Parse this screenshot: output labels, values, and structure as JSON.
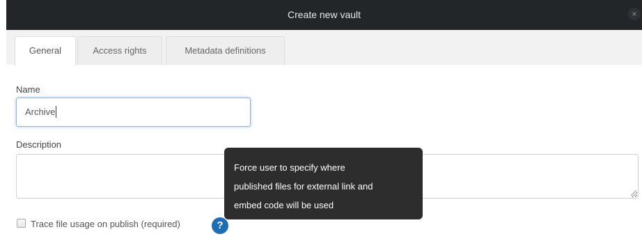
{
  "dialog": {
    "title": "Create new vault",
    "close_icon": "×"
  },
  "tabs": [
    {
      "label": "General",
      "active": true
    },
    {
      "label": "Access rights",
      "active": false
    },
    {
      "label": "Metadata definitions",
      "active": false
    }
  ],
  "form": {
    "name_label": "Name",
    "name_value": "Archive",
    "description_label": "Description",
    "description_value": "",
    "trace_label": "Trace file usage on publish (required)",
    "trace_checked": false,
    "help_icon": "?"
  },
  "tooltip": {
    "lines": [
      "Force user to specify where",
      "published files for external link and",
      "embed code will be used"
    ]
  },
  "colors": {
    "titlebar": "#222629",
    "tabbar": "#f2f2f2",
    "focus_border": "#8fb5dc",
    "help_icon": "#1f6eb5",
    "tooltip_bg": "#2d2d2d"
  }
}
